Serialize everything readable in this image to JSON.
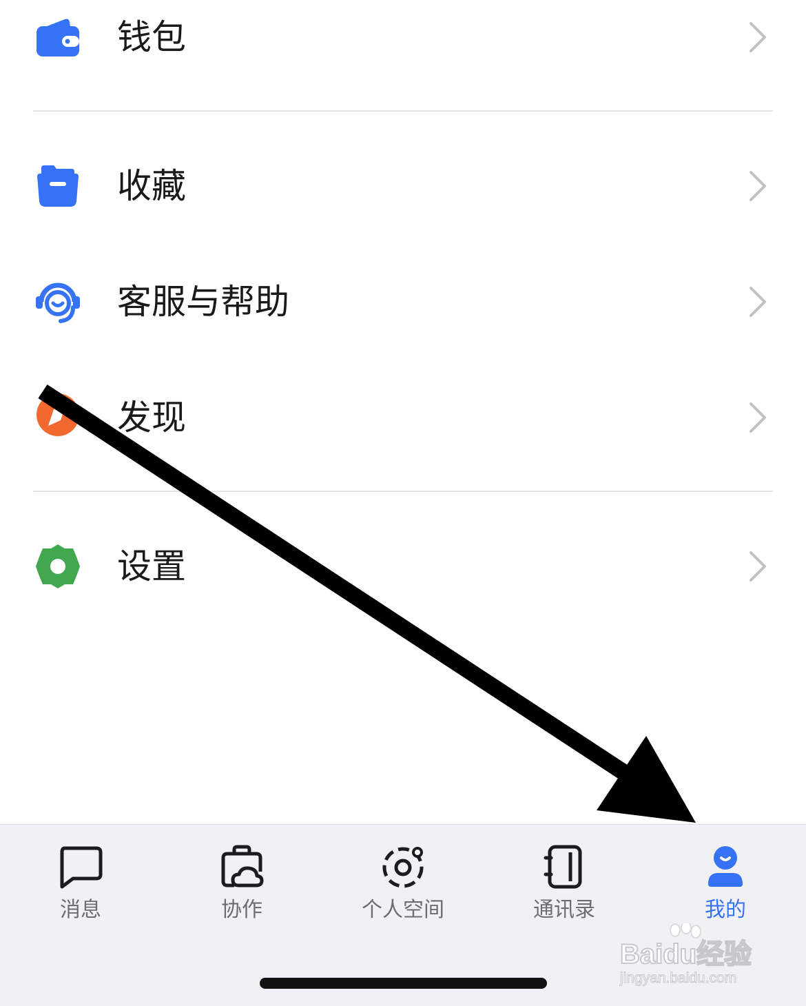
{
  "menu": {
    "items": [
      {
        "label": "钱包",
        "icon": "wallet-icon"
      },
      {
        "label": "收藏",
        "icon": "folder-icon"
      },
      {
        "label": "客服与帮助",
        "icon": "headset-icon"
      },
      {
        "label": "发现",
        "icon": "compass-icon"
      },
      {
        "label": "设置",
        "icon": "gear-icon"
      }
    ]
  },
  "tabbar": {
    "tabs": [
      {
        "label": "消息",
        "icon": "message-icon",
        "active": false
      },
      {
        "label": "协作",
        "icon": "briefcase-cloud-icon",
        "active": false
      },
      {
        "label": "个人空间",
        "icon": "orbit-icon",
        "active": false
      },
      {
        "label": "通讯录",
        "icon": "contacts-book-icon",
        "active": false
      },
      {
        "label": "我的",
        "icon": "person-icon",
        "active": true
      }
    ]
  },
  "watermark": {
    "brand": "Baidu经验",
    "url": "jingyan.baidu.com"
  },
  "colors": {
    "accent_blue": "#3572f6",
    "discover_orange": "#f1692e",
    "settings_green": "#41a84f",
    "tab_inactive": "#6b6d72",
    "chevron_gray": "#c2c2c6"
  }
}
